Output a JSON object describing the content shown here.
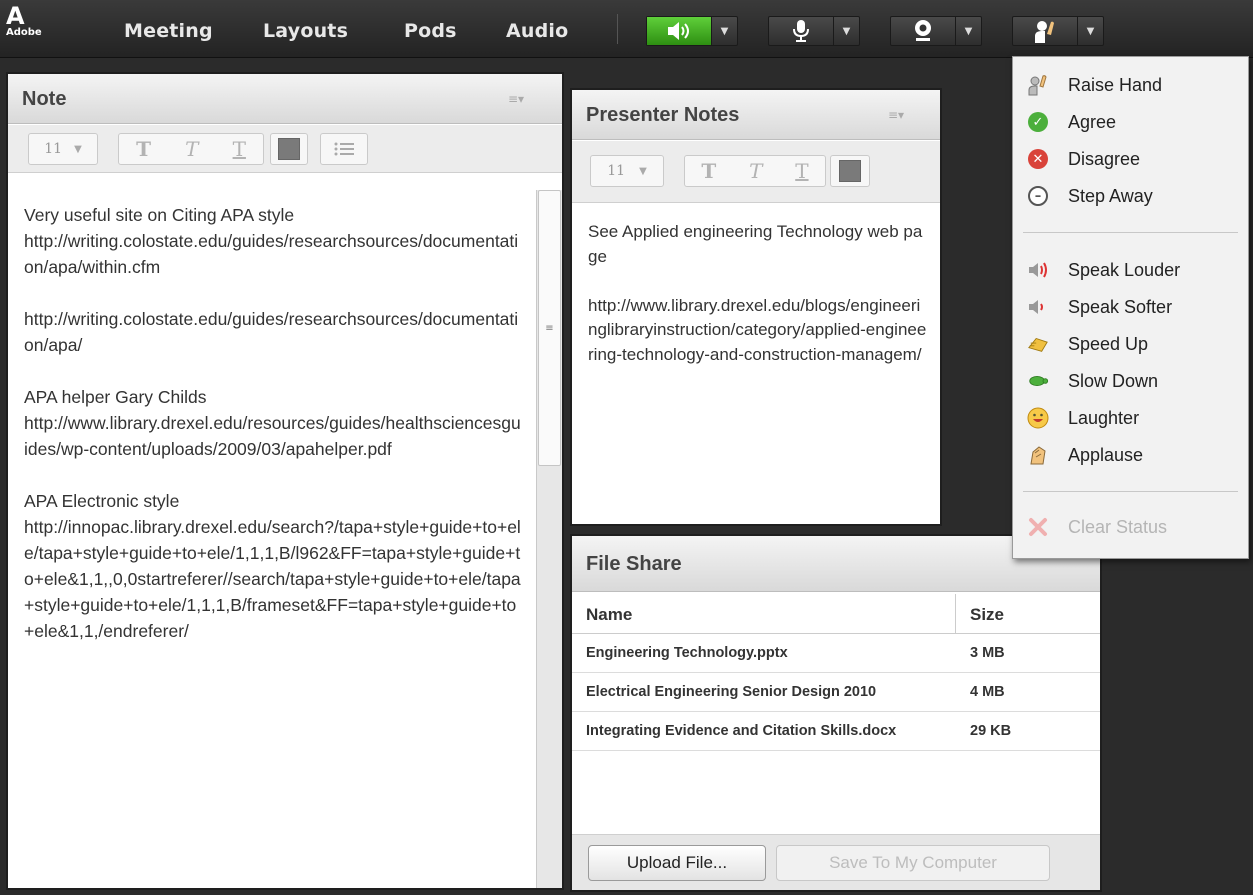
{
  "app": {
    "logo_mark": "A",
    "logo_text": "Adobe"
  },
  "menubar": {
    "items": [
      "Meeting",
      "Layouts",
      "Pods",
      "Audio"
    ],
    "tools": [
      {
        "name": "speaker",
        "state": "active"
      },
      {
        "name": "microphone"
      },
      {
        "name": "webcam"
      },
      {
        "name": "raise-hand-status"
      }
    ]
  },
  "note_pod": {
    "title": "Note",
    "font_size": "11",
    "text": "Very useful site on Citing APA style\nhttp://writing.colostate.edu/guides/researchsources/documentation/apa/within.cfm\n\nhttp://writing.colostate.edu/guides/researchsources/documentation/apa/\n\nAPA helper Gary Childs\nhttp://www.library.drexel.edu/resources/guides/healthsciencesguides/wp-content/uploads/2009/03/apahelper.pdf\n\nAPA Electronic style\nhttp://innopac.library.drexel.edu/search?/tapa+style+guide+to+ele/tapa+style+guide+to+ele/1,1,1,B/l962&FF=tapa+style+guide+to+ele&1,1,,0,0startreferer//search/tapa+style+guide+to+ele/tapa+style+guide+to+ele/1,1,1,B/frameset&FF=tapa+style+guide+to+ele&1,1,/endreferer/"
  },
  "presenter_pod": {
    "title": "Presenter Notes",
    "font_size": "11",
    "text": "See Applied engineering Technology web page\n\nhttp://www.library.drexel.edu/blogs/engineeringlibraryinstruction/category/applied-engineering-technology-and-construction-managem/"
  },
  "file_share": {
    "title": "File Share",
    "columns": {
      "name": "Name",
      "size": "Size"
    },
    "rows": [
      {
        "name": "Engineering Technology.pptx",
        "size": "3 MB"
      },
      {
        "name": "Electrical Engineering Senior Design 2010",
        "size": "4 MB"
      },
      {
        "name": "Integrating Evidence and Citation Skills.docx",
        "size": "29 KB"
      }
    ],
    "upload_label": "Upload File...",
    "save_label": "Save To My Computer"
  },
  "status_menu": {
    "items": [
      {
        "label": "Raise Hand",
        "icon": "raise-hand-icon"
      },
      {
        "label": "Agree",
        "icon": "agree-icon"
      },
      {
        "label": "Disagree",
        "icon": "disagree-icon"
      },
      {
        "label": "Step Away",
        "icon": "step-away-icon"
      },
      {
        "label": "Speak Louder",
        "icon": "speak-louder-icon"
      },
      {
        "label": "Speak Softer",
        "icon": "speak-softer-icon"
      },
      {
        "label": "Speed Up",
        "icon": "speed-up-icon"
      },
      {
        "label": "Slow Down",
        "icon": "slow-down-icon"
      },
      {
        "label": "Laughter",
        "icon": "laughter-icon"
      },
      {
        "label": "Applause",
        "icon": "applause-icon"
      },
      {
        "label": "Clear Status",
        "icon": "clear-status-icon",
        "disabled": true
      }
    ]
  },
  "colors": {
    "accent_green": "#3cb521",
    "agree": "#4caf3c",
    "disagree": "#d9433a"
  }
}
